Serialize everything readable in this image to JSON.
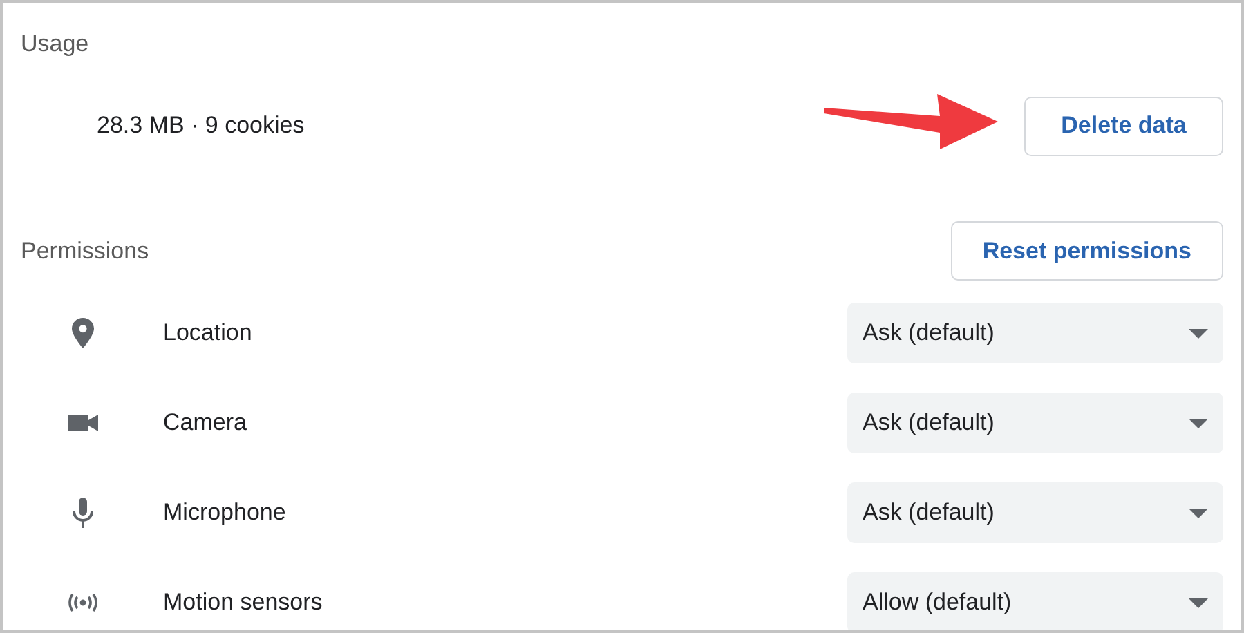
{
  "usage": {
    "heading": "Usage",
    "summary": "28.3 MB · 9 cookies",
    "button": "Delete data"
  },
  "permissions": {
    "heading": "Permissions",
    "reset_button": "Reset permissions",
    "items": [
      {
        "kind": "location",
        "label": "Location",
        "value": "Ask (default)"
      },
      {
        "kind": "camera",
        "label": "Camera",
        "value": "Ask (default)"
      },
      {
        "kind": "microphone",
        "label": "Microphone",
        "value": "Ask (default)"
      },
      {
        "kind": "motion",
        "label": "Motion sensors",
        "value": "Allow (default)"
      }
    ]
  }
}
